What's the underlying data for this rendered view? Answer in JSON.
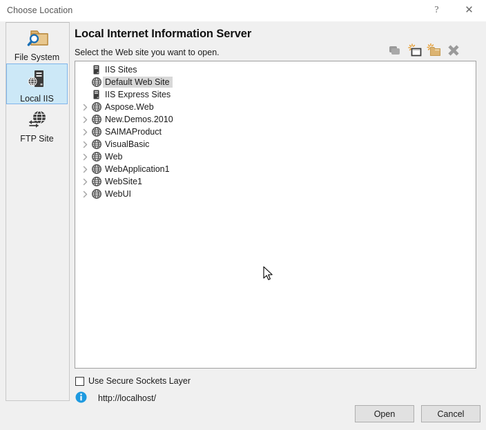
{
  "window": {
    "title": "Choose Location",
    "help_button": "?",
    "close_button": "✕"
  },
  "sidebar": {
    "items": [
      {
        "label": "File System",
        "icon": "folder-search-icon",
        "selected": false
      },
      {
        "label": "Local IIS",
        "icon": "server-globe-icon",
        "selected": true
      },
      {
        "label": "FTP Site",
        "icon": "globe-transfer-icon",
        "selected": false
      }
    ]
  },
  "pane": {
    "heading": "Local Internet Information Server",
    "subheading": "Select the Web site you want to open."
  },
  "toolbar": {
    "buttons": [
      {
        "name": "copy-icon",
        "tooltip": "Copy"
      },
      {
        "name": "new-web-application-icon",
        "tooltip": "Create New Web Application"
      },
      {
        "name": "new-virtual-directory-icon",
        "tooltip": "Create New Virtual Directory"
      },
      {
        "name": "delete-icon",
        "tooltip": "Delete"
      }
    ]
  },
  "tree": {
    "nodes": [
      {
        "label": "IIS Sites",
        "icon": "server-icon",
        "indent": 0,
        "expander": false,
        "selected": false
      },
      {
        "label": "Default Web Site",
        "icon": "globe-icon",
        "indent": 1,
        "expander": false,
        "selected": true
      },
      {
        "label": "IIS Express Sites",
        "icon": "server-icon",
        "indent": 0,
        "expander": false,
        "selected": false
      },
      {
        "label": "Aspose.Web",
        "icon": "globe-icon",
        "indent": 0,
        "expander": true,
        "selected": false
      },
      {
        "label": "New.Demos.2010",
        "icon": "globe-icon",
        "indent": 0,
        "expander": true,
        "selected": false
      },
      {
        "label": "SAIMAProduct",
        "icon": "globe-icon",
        "indent": 0,
        "expander": true,
        "selected": false
      },
      {
        "label": "VisualBasic",
        "icon": "globe-icon",
        "indent": 0,
        "expander": true,
        "selected": false
      },
      {
        "label": "Web",
        "icon": "globe-icon",
        "indent": 0,
        "expander": true,
        "selected": false
      },
      {
        "label": "WebApplication1",
        "icon": "globe-icon",
        "indent": 0,
        "expander": true,
        "selected": false
      },
      {
        "label": "WebSite1",
        "icon": "globe-icon",
        "indent": 0,
        "expander": true,
        "selected": false
      },
      {
        "label": "WebUI",
        "icon": "globe-icon",
        "indent": 0,
        "expander": true,
        "selected": false
      }
    ]
  },
  "footer": {
    "ssl_label": "Use Secure Sockets Layer",
    "ssl_checked": false,
    "url": "http://localhost/",
    "info_icon": "info-icon"
  },
  "buttons": {
    "open_label": "Open",
    "cancel_label": "Cancel"
  },
  "colors": {
    "accent_selection": "#cce8f7",
    "accent_selection_border": "#7eb4ea",
    "tree_selection": "#d8d8d8",
    "dialog_background": "#f0f0f0",
    "info_blue": "#1e9ae0",
    "folder_gold": "#dcb472"
  }
}
